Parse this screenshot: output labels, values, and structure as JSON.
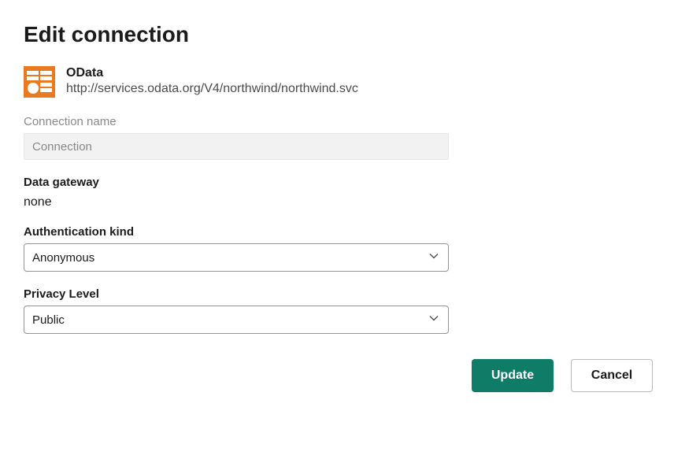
{
  "title": "Edit connection",
  "connection": {
    "type": "OData",
    "url": "http://services.odata.org/V4/northwind/northwind.svc"
  },
  "fields": {
    "connectionName": {
      "label": "Connection name",
      "placeholder": "Connection",
      "value": ""
    },
    "dataGateway": {
      "label": "Data gateway",
      "value": "none"
    },
    "authKind": {
      "label": "Authentication kind",
      "selected": "Anonymous"
    },
    "privacyLevel": {
      "label": "Privacy Level",
      "selected": "Public"
    }
  },
  "buttons": {
    "update": "Update",
    "cancel": "Cancel"
  },
  "colors": {
    "accent": "#0e7c66",
    "iconOrange": "#e97a1f"
  }
}
